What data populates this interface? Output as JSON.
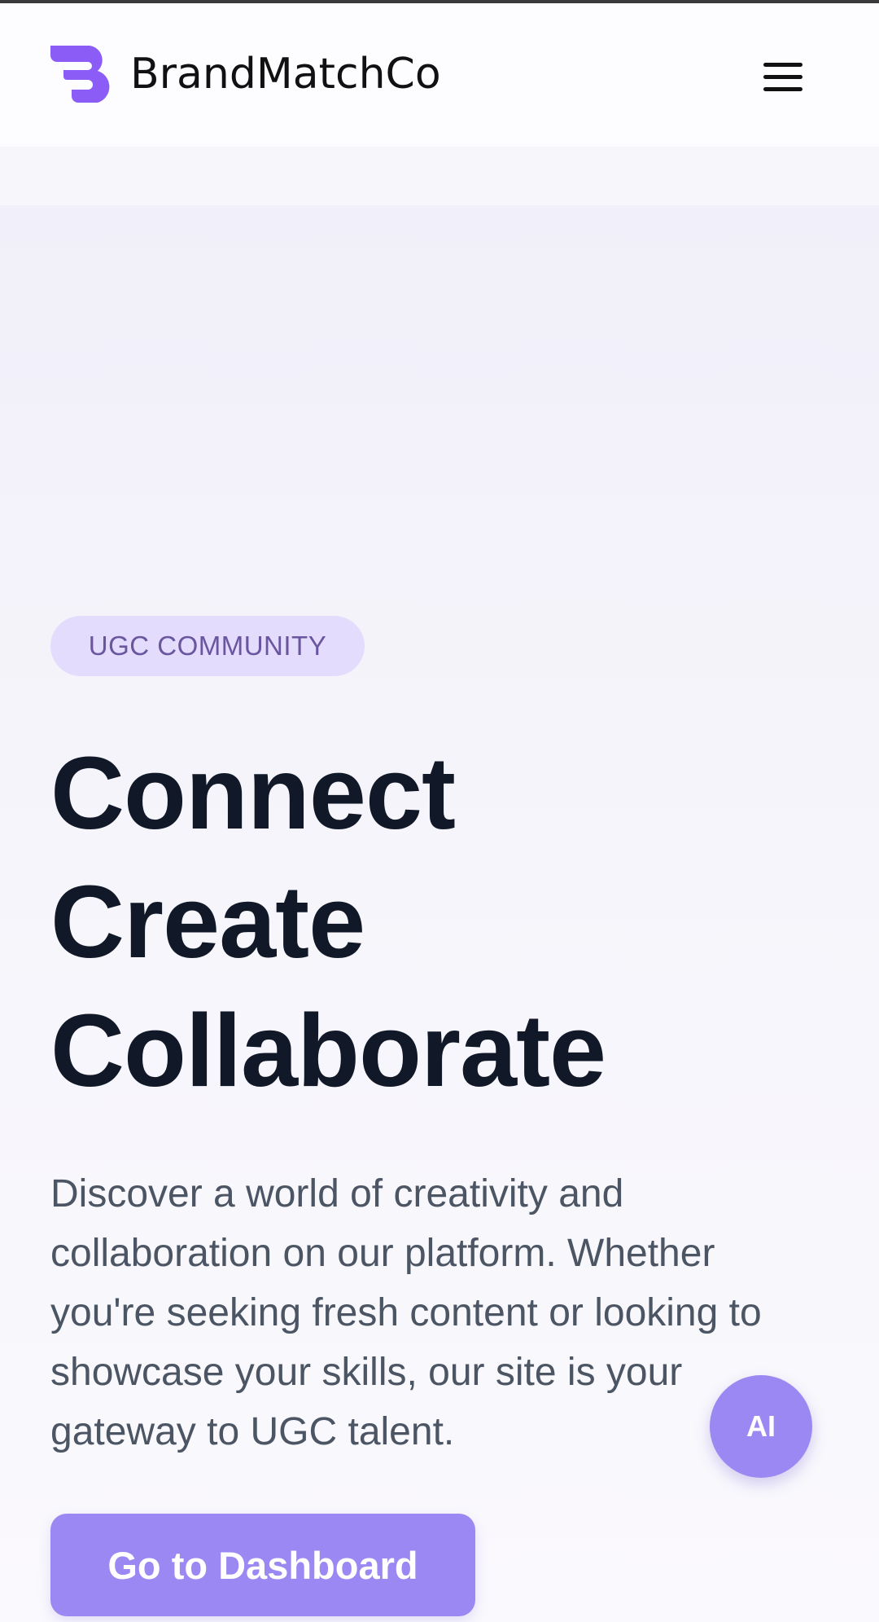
{
  "header": {
    "brand_name": "BrandMatchCo",
    "logo_icon": "brand-logo-icon",
    "menu_icon": "hamburger-menu-icon"
  },
  "hero": {
    "badge": "UGC COMMUNITY",
    "title_lines": [
      "Connect",
      "Create",
      "Collaborate"
    ],
    "description": "Discover a world of creativity and collaboration on our platform. Whether you're seeking fresh content or looking to showcase your skills, our site is your gateway to UGC talent.",
    "cta_label": "Go to Dashboard"
  },
  "ai_assistant": {
    "label": "AI"
  },
  "colors": {
    "accent": "#9b88f2",
    "logo": "#8b5cf6",
    "badge_bg": "#e4dcfd",
    "badge_text": "#6a559f",
    "title": "#111827",
    "body_text": "#4b5563"
  }
}
